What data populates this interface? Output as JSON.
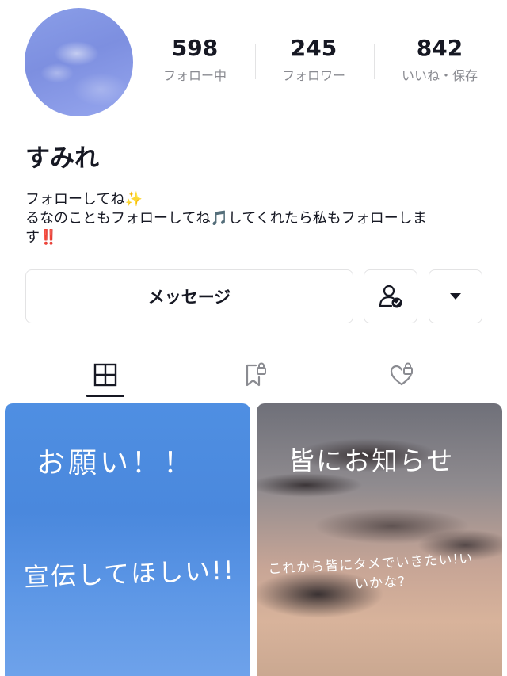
{
  "profile": {
    "name": "すみれ",
    "stats": [
      {
        "value": "598",
        "label": "フォロー中"
      },
      {
        "value": "245",
        "label": "フォロワー"
      },
      {
        "value": "842",
        "label": "いいね・保存"
      }
    ],
    "bio": [
      "フォローしてね✨",
      "るなのこともフォローしてね🎵してくれたら私もフォローしま",
      "す‼️"
    ]
  },
  "actions": {
    "message_label": "メッセージ",
    "friend_icon": "user-check-icon",
    "more_icon": "caret-down-icon"
  },
  "tabs": [
    {
      "name": "posts",
      "icon": "grid-icon",
      "active": true
    },
    {
      "name": "saved",
      "icon": "bookmark-lock-icon",
      "active": false
    },
    {
      "name": "liked",
      "icon": "heart-lock-icon",
      "active": false
    }
  ],
  "posts": [
    {
      "title": "お願い！！",
      "caption": "宣伝してほしい!!"
    },
    {
      "title": "皆にお知らせ",
      "caption_line1": "これから皆にタメでいきたい!い",
      "caption_line2": "いかな?"
    }
  ],
  "colors": {
    "text": "#161823",
    "muted": "#8a8b91",
    "border": "#e3e3e4",
    "tile_blue": "#4f8fe2"
  }
}
